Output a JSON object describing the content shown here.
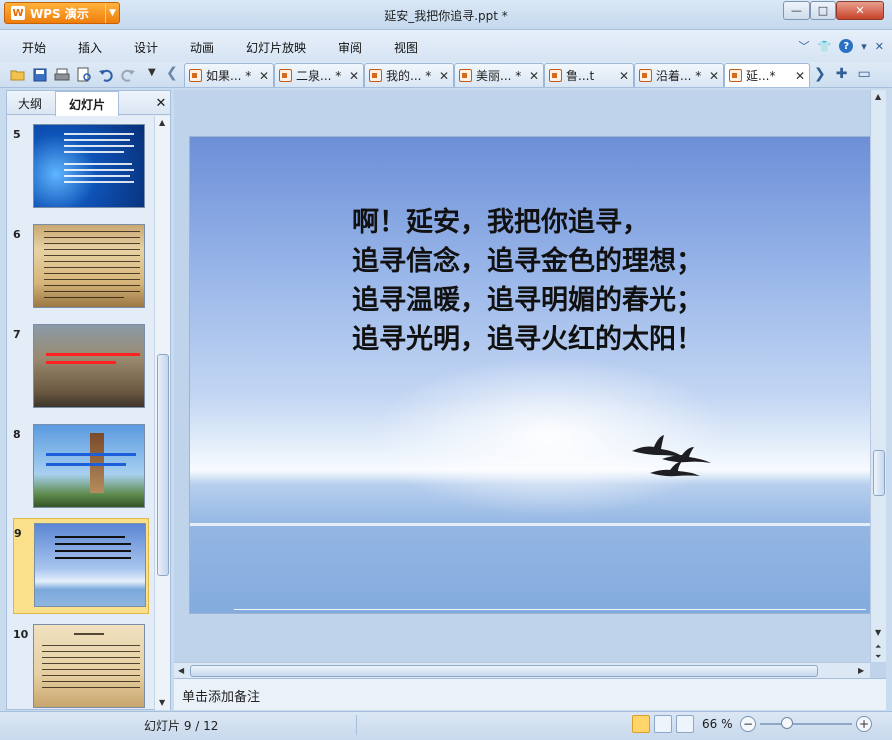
{
  "app": {
    "name": "WPS 演示",
    "title": "延安_我把你追寻.ppt *"
  },
  "menu": [
    "开始",
    "插入",
    "设计",
    "动画",
    "幻灯片放映",
    "审阅",
    "视图"
  ],
  "tabs": [
    {
      "label": "如果... *"
    },
    {
      "label": "二泉... *"
    },
    {
      "label": "我的... *"
    },
    {
      "label": "美丽... *"
    },
    {
      "label": "鲁...t"
    },
    {
      "label": "沿着... *"
    },
    {
      "label": "延...*"
    }
  ],
  "panel": {
    "outline_tab": "大纲",
    "slides_tab": "幻灯片"
  },
  "thumbnails": [
    {
      "number": "5"
    },
    {
      "number": "6"
    },
    {
      "number": "7"
    },
    {
      "number": "8"
    },
    {
      "number": "9"
    },
    {
      "number": "10"
    }
  ],
  "slide": {
    "poem_lines": [
      "啊！延安，我把你追寻，",
      "追寻信念，追寻金色的理想；",
      "追寻温暖，追寻明媚的春光；",
      "追寻光明，追寻火红的太阳！"
    ]
  },
  "notes": {
    "placeholder": "单击添加备注"
  },
  "status": {
    "slide_counter": "幻灯片 9 / 12",
    "zoom": "66 %"
  },
  "colors": {
    "app_button": "#f07d0b",
    "selected_thumb": "#fbe08c",
    "close_button": "#c7432a"
  }
}
